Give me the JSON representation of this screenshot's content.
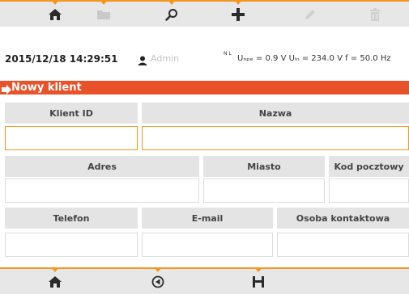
{
  "toolbar_top": {
    "buttons": [
      {
        "name": "home-icon",
        "enabled": true
      },
      {
        "name": "folder-icon",
        "enabled": false
      },
      {
        "name": "search-icon",
        "enabled": true
      },
      {
        "name": "add-icon",
        "enabled": true
      },
      {
        "name": "edit-icon",
        "enabled": false
      },
      {
        "name": "delete-icon",
        "enabled": false
      }
    ]
  },
  "status": {
    "datetime": "2015/12/18 14:29:51",
    "user": "Admin",
    "meas_icon": "N L",
    "measurements": "Uₙₚₑ = 0.9 V Uₗₙ = 234.0 V f = 50.0 Hz"
  },
  "section": {
    "title": "Nowy klient"
  },
  "form": {
    "client_id_label": "Klient ID",
    "client_id_value": "",
    "name_label": "Nazwa",
    "name_value": "",
    "address_label": "Adres",
    "address_value": "",
    "city_label": "Miasto",
    "city_value": "",
    "postal_label": "Kod pocztowy",
    "postal_value": "",
    "phone_label": "Telefon",
    "phone_value": "",
    "email_label": "E-mail",
    "email_value": "",
    "contact_label": "Osoba kontaktowa",
    "contact_value": ""
  },
  "toolbar_bottom": {
    "buttons": [
      {
        "name": "home-icon",
        "enabled": true
      },
      {
        "name": "back-icon",
        "enabled": true
      },
      {
        "name": "save-icon",
        "enabled": true
      }
    ]
  },
  "colors": {
    "accent": "#f7941d",
    "header_red": "#e8522a",
    "toolbar_bg": "#e7e7e7",
    "label_bg": "#e4e4e4"
  }
}
